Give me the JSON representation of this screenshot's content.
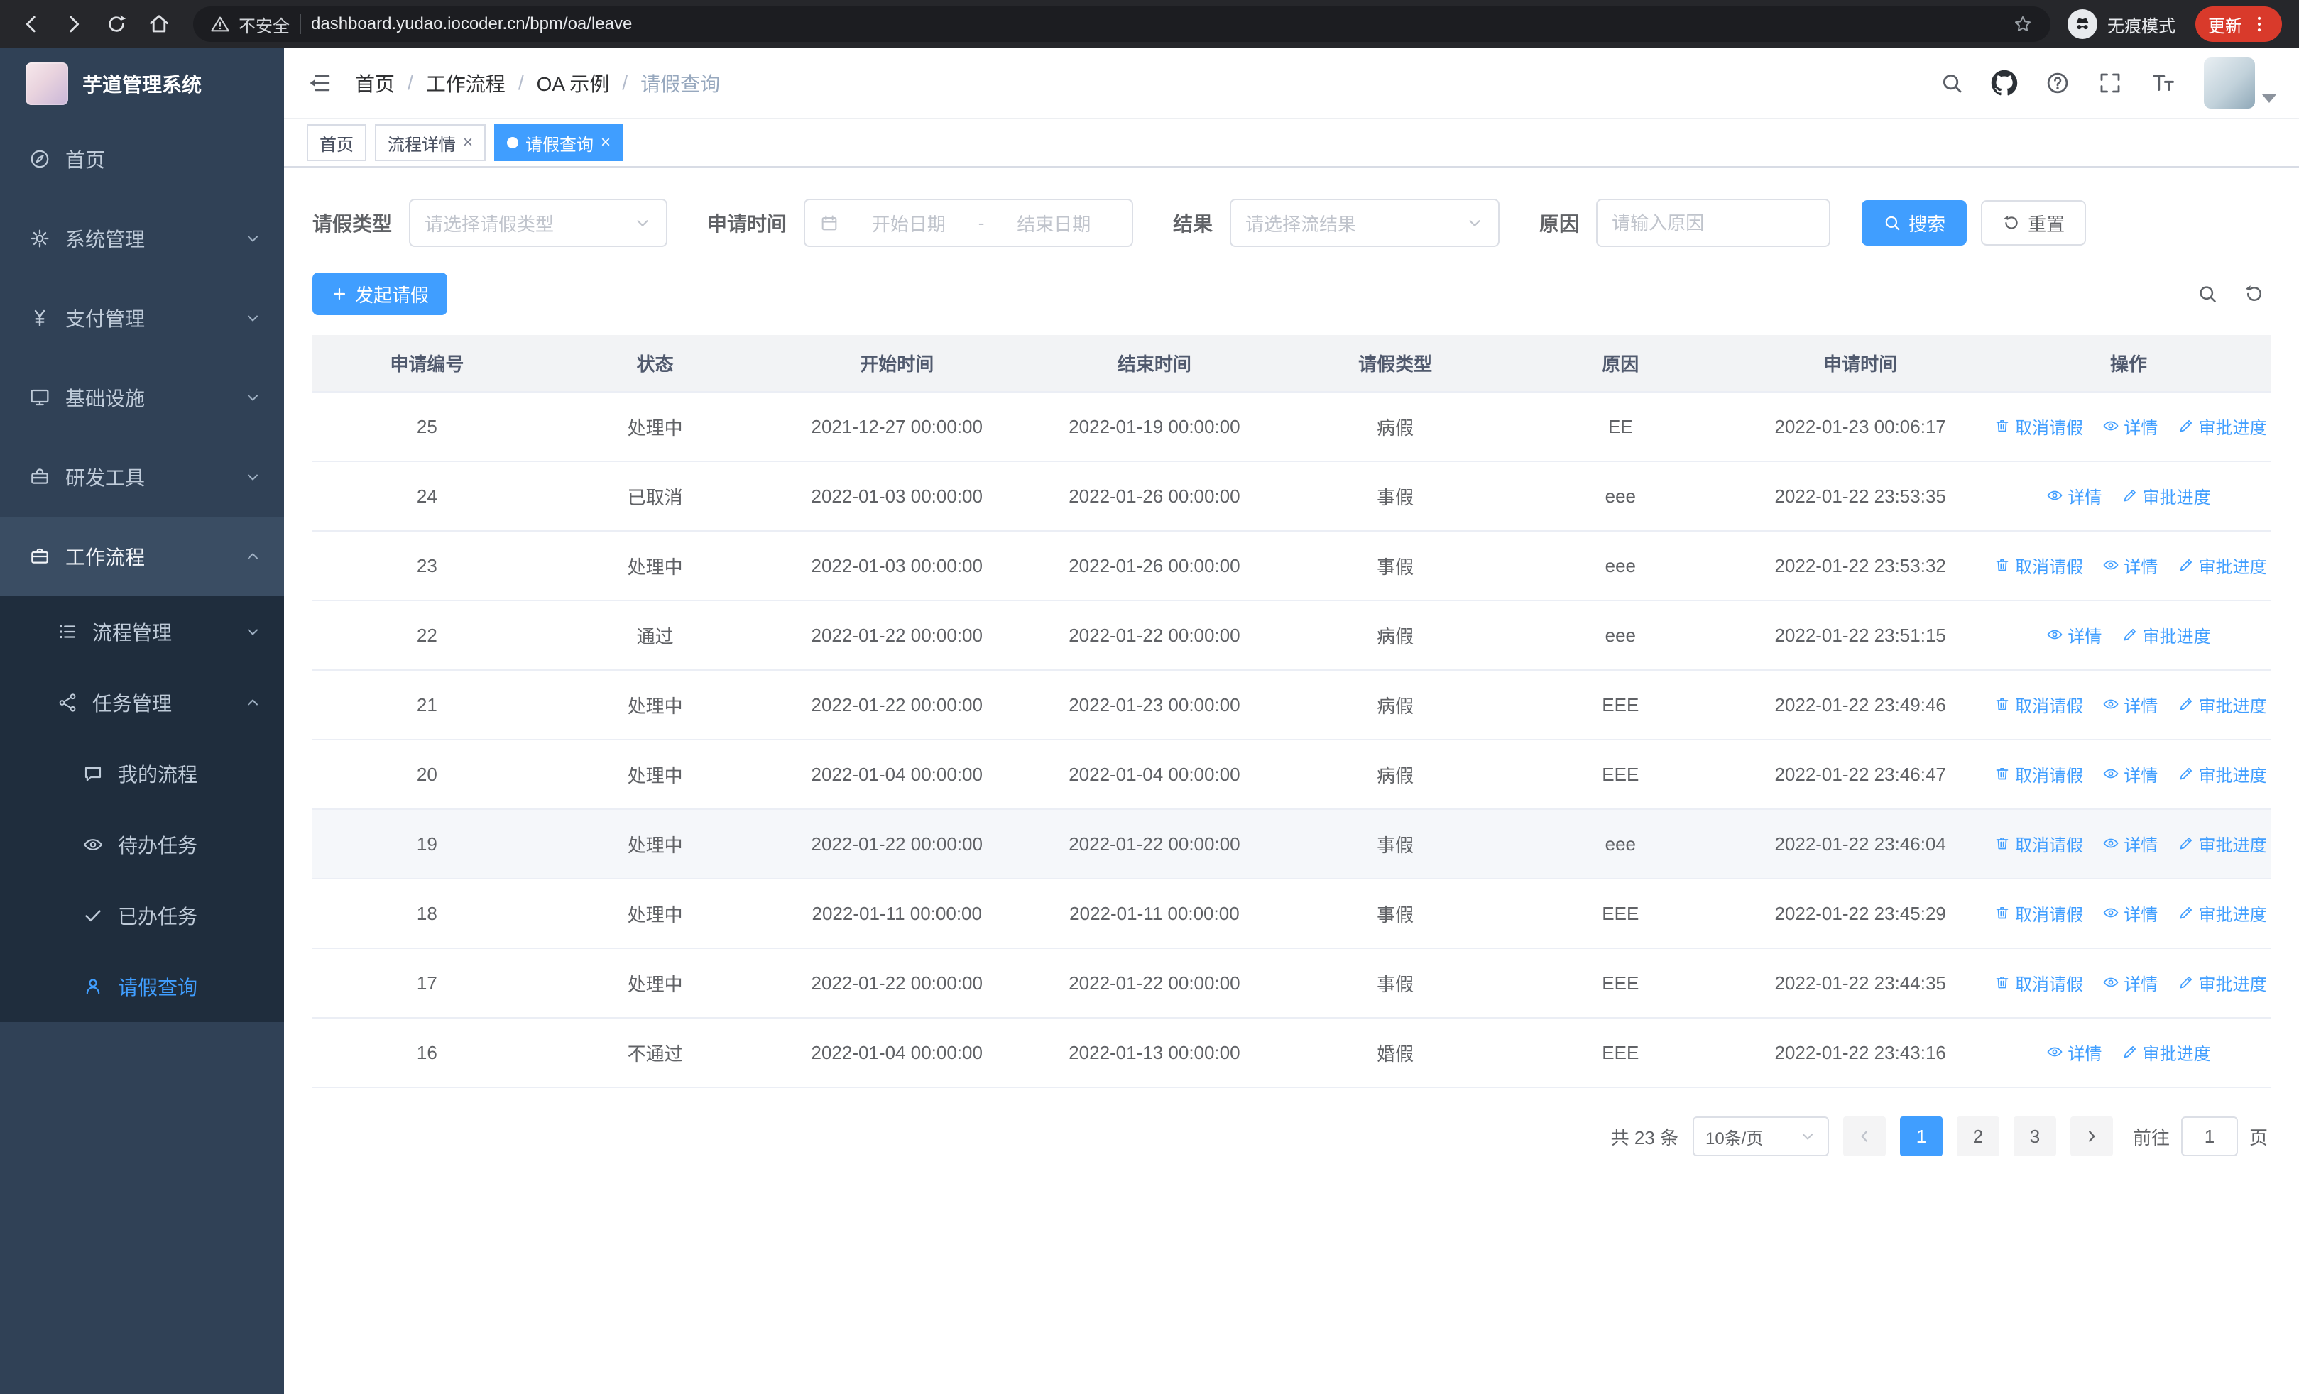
{
  "browser": {
    "security_label": "不安全",
    "url": "dashboard.yudao.iocoder.cn/bpm/oa/leave",
    "incognito_label": "无痕模式",
    "update_label": "更新"
  },
  "glyphs": {
    "close": "×"
  },
  "sidebar": {
    "app_title": "芋道管理系统",
    "items": [
      {
        "label": "首页"
      },
      {
        "label": "系统管理"
      },
      {
        "label": "支付管理"
      },
      {
        "label": "基础设施"
      },
      {
        "label": "研发工具"
      },
      {
        "label": "工作流程"
      }
    ],
    "process_mgmt_label": "流程管理",
    "task_mgmt_label": "任务管理",
    "task_children": [
      {
        "label": "我的流程"
      },
      {
        "label": "待办任务"
      },
      {
        "label": "已办任务"
      },
      {
        "label": "请假查询"
      }
    ]
  },
  "header": {
    "separator": "/",
    "breadcrumbs": [
      {
        "label": "首页"
      },
      {
        "label": "工作流程"
      },
      {
        "label": "OA 示例"
      },
      {
        "label": "请假查询"
      }
    ]
  },
  "tabs": [
    {
      "label": "首页"
    },
    {
      "label": "流程详情"
    },
    {
      "label": "请假查询"
    }
  ],
  "filters": {
    "leave_type_label": "请假类型",
    "leave_type_placeholder": "请选择请假类型",
    "apply_time_label": "申请时间",
    "date_start_placeholder": "开始日期",
    "date_separator": "-",
    "date_end_placeholder": "结束日期",
    "result_label": "结果",
    "result_placeholder": "请选择流结果",
    "reason_label": "原因",
    "reason_placeholder": "请输入原因",
    "search_label": "搜索",
    "reset_label": "重置"
  },
  "toolbar": {
    "create_label": "发起请假"
  },
  "table": {
    "columns": [
      "申请编号",
      "状态",
      "开始时间",
      "结束时间",
      "请假类型",
      "原因",
      "申请时间",
      "操作"
    ],
    "action_labels": {
      "cancel": "取消请假",
      "detail": "详情",
      "progress": "审批进度"
    },
    "rows": [
      {
        "id": "25",
        "status": "处理中",
        "start_time": "2021-12-27 00:00:00",
        "end_time": "2022-01-19 00:00:00",
        "leave_type": "病假",
        "reason": "EE",
        "apply_time": "2022-01-23 00:06:17",
        "can_cancel": true,
        "highlighted": false
      },
      {
        "id": "24",
        "status": "已取消",
        "start_time": "2022-01-03 00:00:00",
        "end_time": "2022-01-26 00:00:00",
        "leave_type": "事假",
        "reason": "eee",
        "apply_time": "2022-01-22 23:53:35",
        "can_cancel": false,
        "highlighted": false
      },
      {
        "id": "23",
        "status": "处理中",
        "start_time": "2022-01-03 00:00:00",
        "end_time": "2022-01-26 00:00:00",
        "leave_type": "事假",
        "reason": "eee",
        "apply_time": "2022-01-22 23:53:32",
        "can_cancel": true,
        "highlighted": false
      },
      {
        "id": "22",
        "status": "通过",
        "start_time": "2022-01-22 00:00:00",
        "end_time": "2022-01-22 00:00:00",
        "leave_type": "病假",
        "reason": "eee",
        "apply_time": "2022-01-22 23:51:15",
        "can_cancel": false,
        "highlighted": false
      },
      {
        "id": "21",
        "status": "处理中",
        "start_time": "2022-01-22 00:00:00",
        "end_time": "2022-01-23 00:00:00",
        "leave_type": "病假",
        "reason": "EEE",
        "apply_time": "2022-01-22 23:49:46",
        "can_cancel": true,
        "highlighted": false
      },
      {
        "id": "20",
        "status": "处理中",
        "start_time": "2022-01-04 00:00:00",
        "end_time": "2022-01-04 00:00:00",
        "leave_type": "病假",
        "reason": "EEE",
        "apply_time": "2022-01-22 23:46:47",
        "can_cancel": true,
        "highlighted": false
      },
      {
        "id": "19",
        "status": "处理中",
        "start_time": "2022-01-22 00:00:00",
        "end_time": "2022-01-22 00:00:00",
        "leave_type": "事假",
        "reason": "eee",
        "apply_time": "2022-01-22 23:46:04",
        "can_cancel": true,
        "highlighted": true
      },
      {
        "id": "18",
        "status": "处理中",
        "start_time": "2022-01-11 00:00:00",
        "end_time": "2022-01-11 00:00:00",
        "leave_type": "事假",
        "reason": "EEE",
        "apply_time": "2022-01-22 23:45:29",
        "can_cancel": true,
        "highlighted": false
      },
      {
        "id": "17",
        "status": "处理中",
        "start_time": "2022-01-22 00:00:00",
        "end_time": "2022-01-22 00:00:00",
        "leave_type": "事假",
        "reason": "EEE",
        "apply_time": "2022-01-22 23:44:35",
        "can_cancel": true,
        "highlighted": false
      },
      {
        "id": "16",
        "status": "不通过",
        "start_time": "2022-01-04 00:00:00",
        "end_time": "2022-01-13 00:00:00",
        "leave_type": "婚假",
        "reason": "EEE",
        "apply_time": "2022-01-22 23:43:16",
        "can_cancel": false,
        "highlighted": false
      }
    ]
  },
  "pagination": {
    "total_text": "共 23 条",
    "page_size_text": "10条/页",
    "pages": [
      "1",
      "2",
      "3"
    ],
    "goto_label": "前往",
    "goto_value": "1",
    "goto_unit": "页"
  },
  "colors": {
    "primary": "#409eff",
    "sidebar_bg": "#304156",
    "submenu_bg": "#1f2d3d"
  }
}
